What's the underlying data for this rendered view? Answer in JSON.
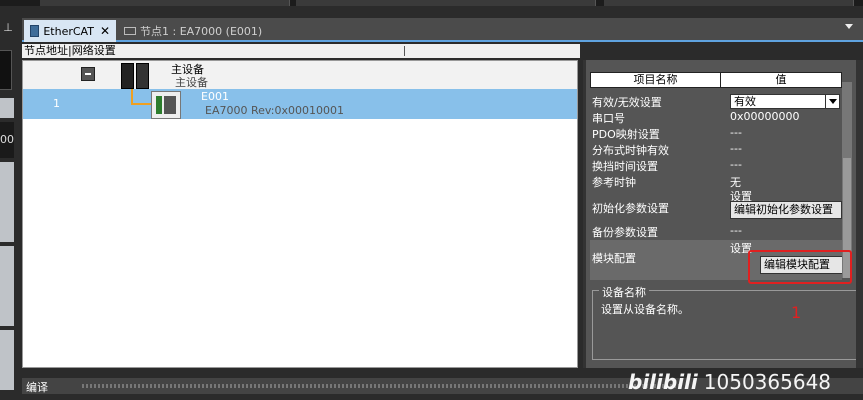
{
  "tabs": {
    "active_label": "EtherCAT",
    "active_close": "✕",
    "inactive_label": "节点1 : EA7000 (E001)"
  },
  "left_panel": {
    "pin_glyph": "⊥",
    "value_fragment": "00"
  },
  "network": {
    "header_label": "节点地址|网络设置",
    "master_name": "主设备",
    "master_subname": "主设备",
    "slave_number": "1",
    "slave_name": "E001",
    "slave_model": "EA7000 Rev:0x00010001"
  },
  "properties": {
    "col_name": "项目名称",
    "col_value": "值",
    "rows": [
      {
        "key": "有效/无效设置",
        "value": "有效"
      },
      {
        "key": "串口号",
        "value": "0x00000000"
      },
      {
        "key": "PDO映射设置",
        "value": "---"
      },
      {
        "key": "分布式时钟有效",
        "value": "---"
      },
      {
        "key": "换挡时间设置",
        "value": "---"
      },
      {
        "key": "参考时钟",
        "value": "无"
      },
      {
        "key": "初始化参数设置",
        "value": "设置"
      },
      {
        "key": "备份参数设置",
        "value": "---"
      },
      {
        "key": "模块配置",
        "value": "设置"
      }
    ],
    "btn_init_params": "编辑初始化参数设置",
    "btn_module_config": "编辑模块配置"
  },
  "description": {
    "title": "设备名称",
    "text": "设置从设备名称。",
    "annotation_number": "1"
  },
  "bottom": {
    "label": "编译"
  },
  "watermark": {
    "brand": "bilibili",
    "id": "1050365648"
  },
  "colors": {
    "selection_row": "#88c0ea",
    "tab_underline": "#5fa3e0",
    "highlight_red": "#e02020",
    "connector": "#f0a020"
  }
}
